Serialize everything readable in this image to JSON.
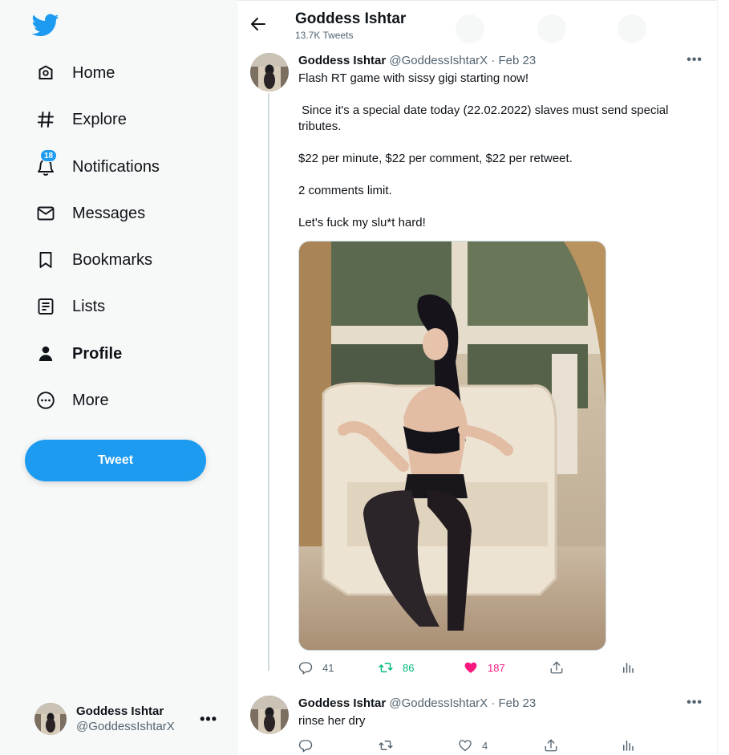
{
  "sidebar": {
    "items": [
      {
        "label": "Home",
        "icon": "home-icon"
      },
      {
        "label": "Explore",
        "icon": "hashtag-icon"
      },
      {
        "label": "Notifications",
        "icon": "bell-icon",
        "badge": "18"
      },
      {
        "label": "Messages",
        "icon": "envelope-icon"
      },
      {
        "label": "Bookmarks",
        "icon": "bookmark-icon"
      },
      {
        "label": "Lists",
        "icon": "list-icon"
      },
      {
        "label": "Profile",
        "icon": "person-icon",
        "active": true
      },
      {
        "label": "More",
        "icon": "more-circle-icon"
      }
    ],
    "tweet_button": "Tweet",
    "account": {
      "name": "Goddess Ishtar",
      "handle": "@GoddessIshtarX"
    }
  },
  "header": {
    "title": "Goddess Ishtar",
    "subtitle": "13.7K Tweets"
  },
  "tweets": [
    {
      "name": "Goddess Ishtar",
      "meta": "@GoddessIshtarX · Feb 23",
      "paragraphs": [
        "Flash RT game with sissy gigi starting now!",
        " Since it's a special date today (22.02.2022) slaves must send special tributes.",
        "$22 per minute, $22 per comment, $22 per retweet.",
        "2 comments limit.",
        "Let's fuck my slu*t hard!"
      ],
      "replies": "41",
      "retweets": "86",
      "likes": "187"
    },
    {
      "name": "Goddess Ishtar",
      "meta": "@GoddessIshtarX · Feb 23",
      "paragraphs": [
        "rinse her dry"
      ],
      "replies": "",
      "retweets": "",
      "likes": "4"
    }
  ],
  "colors": {
    "accent": "#1d9bf0",
    "retweet": "#00ba7c",
    "like": "#f91880",
    "muted": "#536471"
  }
}
